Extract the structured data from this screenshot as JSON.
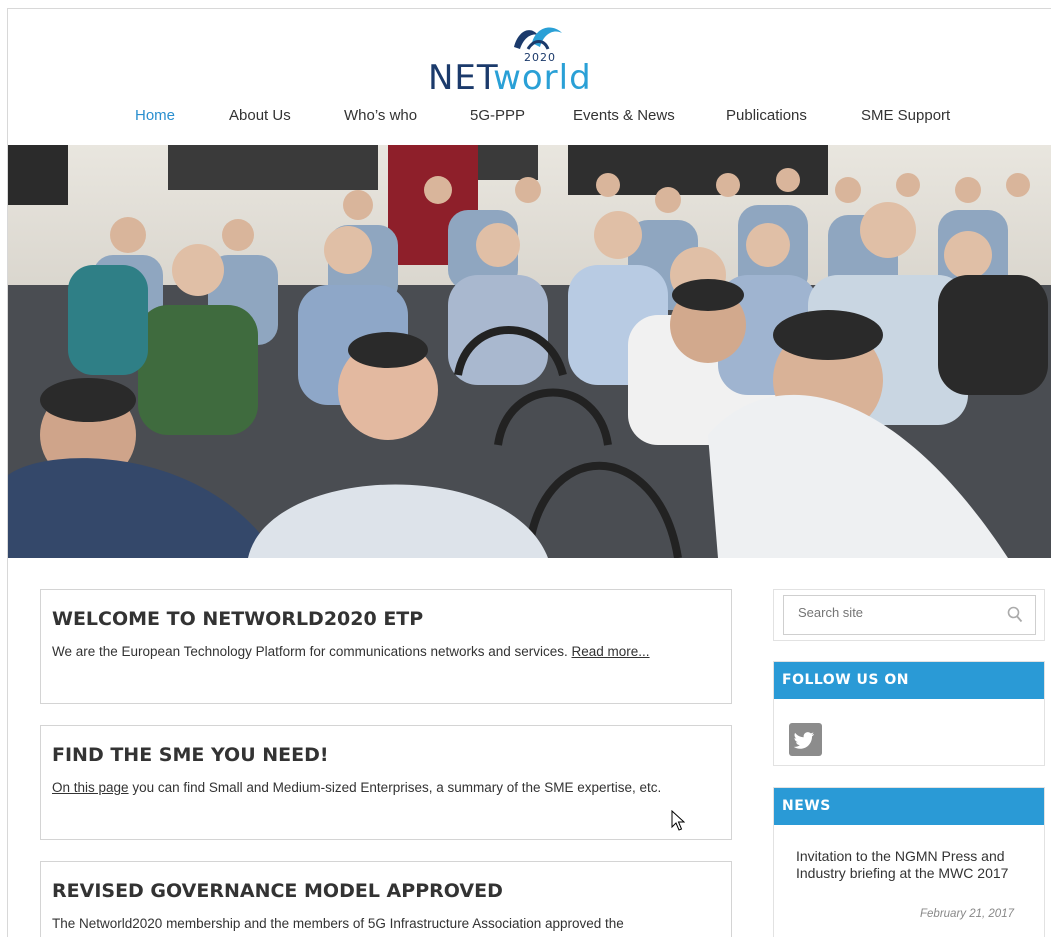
{
  "logo": {
    "year": "2020",
    "word_a": "NET",
    "word_b": "world"
  },
  "nav": {
    "items": [
      {
        "label": "Home",
        "active": true
      },
      {
        "label": "About Us"
      },
      {
        "label": "Who’s who"
      },
      {
        "label": "5G-PPP"
      },
      {
        "label": "Events & News"
      },
      {
        "label": "Publications"
      },
      {
        "label": "SME Support"
      }
    ]
  },
  "main": {
    "welcome": {
      "title": "WELCOME TO NETWORLD2020 ETP",
      "text": "We are the European Technology Platform for communications networks and services. ",
      "link": "Read more..."
    },
    "sme": {
      "title": "FIND THE SME YOU NEED!",
      "link": "On this page",
      "text": " you can find Small and Medium-sized Enterprises, a summary of the SME expertise, etc."
    },
    "governance": {
      "title": "REVISED GOVERNANCE MODEL APPROVED",
      "text": "The Networld2020 membership and the members of 5G Infrastructure Association approved the"
    }
  },
  "sidebar": {
    "search": {
      "placeholder": "Search site"
    },
    "follow": {
      "title": "FOLLOW US ON",
      "icon": "twitter-icon"
    },
    "news": {
      "title": "NEWS",
      "item": "Invitation to the NGMN Press and Industry briefing at the MWC 2017",
      "date": "February 21, 2017"
    }
  },
  "colors": {
    "accent": "#2a9ad6",
    "nav_active": "#2a8fcf",
    "logo_dark": "#1b3a6b",
    "logo_light": "#2aa0d6"
  }
}
